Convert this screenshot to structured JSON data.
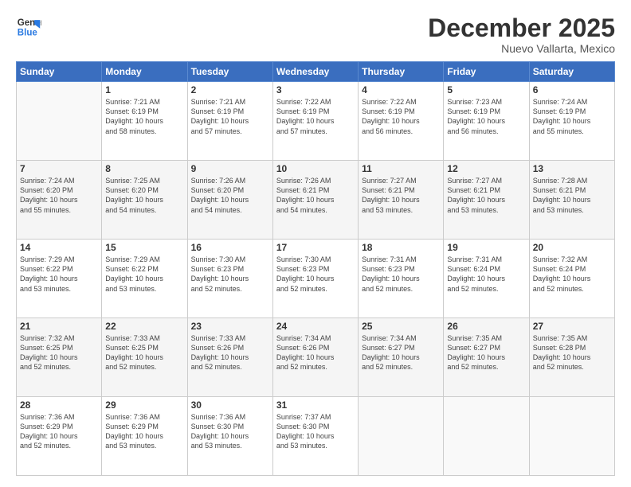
{
  "logo": {
    "line1": "General",
    "line2": "Blue"
  },
  "header": {
    "month": "December 2025",
    "location": "Nuevo Vallarta, Mexico"
  },
  "weekdays": [
    "Sunday",
    "Monday",
    "Tuesday",
    "Wednesday",
    "Thursday",
    "Friday",
    "Saturday"
  ],
  "weeks": [
    [
      {
        "num": "",
        "info": ""
      },
      {
        "num": "1",
        "info": "Sunrise: 7:21 AM\nSunset: 6:19 PM\nDaylight: 10 hours\nand 58 minutes."
      },
      {
        "num": "2",
        "info": "Sunrise: 7:21 AM\nSunset: 6:19 PM\nDaylight: 10 hours\nand 57 minutes."
      },
      {
        "num": "3",
        "info": "Sunrise: 7:22 AM\nSunset: 6:19 PM\nDaylight: 10 hours\nand 57 minutes."
      },
      {
        "num": "4",
        "info": "Sunrise: 7:22 AM\nSunset: 6:19 PM\nDaylight: 10 hours\nand 56 minutes."
      },
      {
        "num": "5",
        "info": "Sunrise: 7:23 AM\nSunset: 6:19 PM\nDaylight: 10 hours\nand 56 minutes."
      },
      {
        "num": "6",
        "info": "Sunrise: 7:24 AM\nSunset: 6:19 PM\nDaylight: 10 hours\nand 55 minutes."
      }
    ],
    [
      {
        "num": "7",
        "info": "Sunrise: 7:24 AM\nSunset: 6:20 PM\nDaylight: 10 hours\nand 55 minutes."
      },
      {
        "num": "8",
        "info": "Sunrise: 7:25 AM\nSunset: 6:20 PM\nDaylight: 10 hours\nand 54 minutes."
      },
      {
        "num": "9",
        "info": "Sunrise: 7:26 AM\nSunset: 6:20 PM\nDaylight: 10 hours\nand 54 minutes."
      },
      {
        "num": "10",
        "info": "Sunrise: 7:26 AM\nSunset: 6:21 PM\nDaylight: 10 hours\nand 54 minutes."
      },
      {
        "num": "11",
        "info": "Sunrise: 7:27 AM\nSunset: 6:21 PM\nDaylight: 10 hours\nand 53 minutes."
      },
      {
        "num": "12",
        "info": "Sunrise: 7:27 AM\nSunset: 6:21 PM\nDaylight: 10 hours\nand 53 minutes."
      },
      {
        "num": "13",
        "info": "Sunrise: 7:28 AM\nSunset: 6:21 PM\nDaylight: 10 hours\nand 53 minutes."
      }
    ],
    [
      {
        "num": "14",
        "info": "Sunrise: 7:29 AM\nSunset: 6:22 PM\nDaylight: 10 hours\nand 53 minutes."
      },
      {
        "num": "15",
        "info": "Sunrise: 7:29 AM\nSunset: 6:22 PM\nDaylight: 10 hours\nand 53 minutes."
      },
      {
        "num": "16",
        "info": "Sunrise: 7:30 AM\nSunset: 6:23 PM\nDaylight: 10 hours\nand 52 minutes."
      },
      {
        "num": "17",
        "info": "Sunrise: 7:30 AM\nSunset: 6:23 PM\nDaylight: 10 hours\nand 52 minutes."
      },
      {
        "num": "18",
        "info": "Sunrise: 7:31 AM\nSunset: 6:23 PM\nDaylight: 10 hours\nand 52 minutes."
      },
      {
        "num": "19",
        "info": "Sunrise: 7:31 AM\nSunset: 6:24 PM\nDaylight: 10 hours\nand 52 minutes."
      },
      {
        "num": "20",
        "info": "Sunrise: 7:32 AM\nSunset: 6:24 PM\nDaylight: 10 hours\nand 52 minutes."
      }
    ],
    [
      {
        "num": "21",
        "info": "Sunrise: 7:32 AM\nSunset: 6:25 PM\nDaylight: 10 hours\nand 52 minutes."
      },
      {
        "num": "22",
        "info": "Sunrise: 7:33 AM\nSunset: 6:25 PM\nDaylight: 10 hours\nand 52 minutes."
      },
      {
        "num": "23",
        "info": "Sunrise: 7:33 AM\nSunset: 6:26 PM\nDaylight: 10 hours\nand 52 minutes."
      },
      {
        "num": "24",
        "info": "Sunrise: 7:34 AM\nSunset: 6:26 PM\nDaylight: 10 hours\nand 52 minutes."
      },
      {
        "num": "25",
        "info": "Sunrise: 7:34 AM\nSunset: 6:27 PM\nDaylight: 10 hours\nand 52 minutes."
      },
      {
        "num": "26",
        "info": "Sunrise: 7:35 AM\nSunset: 6:27 PM\nDaylight: 10 hours\nand 52 minutes."
      },
      {
        "num": "27",
        "info": "Sunrise: 7:35 AM\nSunset: 6:28 PM\nDaylight: 10 hours\nand 52 minutes."
      }
    ],
    [
      {
        "num": "28",
        "info": "Sunrise: 7:36 AM\nSunset: 6:29 PM\nDaylight: 10 hours\nand 52 minutes."
      },
      {
        "num": "29",
        "info": "Sunrise: 7:36 AM\nSunset: 6:29 PM\nDaylight: 10 hours\nand 53 minutes."
      },
      {
        "num": "30",
        "info": "Sunrise: 7:36 AM\nSunset: 6:30 PM\nDaylight: 10 hours\nand 53 minutes."
      },
      {
        "num": "31",
        "info": "Sunrise: 7:37 AM\nSunset: 6:30 PM\nDaylight: 10 hours\nand 53 minutes."
      },
      {
        "num": "",
        "info": ""
      },
      {
        "num": "",
        "info": ""
      },
      {
        "num": "",
        "info": ""
      }
    ]
  ]
}
